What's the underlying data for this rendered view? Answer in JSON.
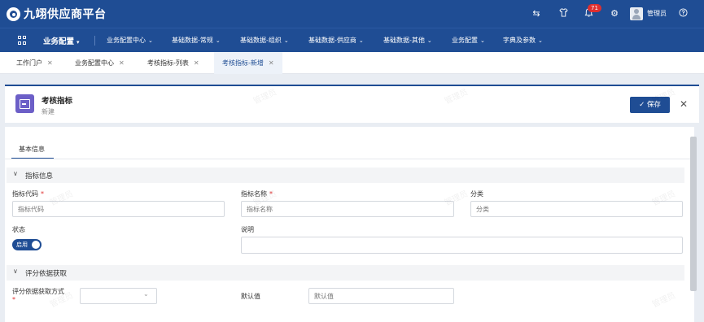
{
  "app": {
    "title": "九翊供应商平台",
    "user": "管理员",
    "notification_count": "71"
  },
  "topbar_icons": [
    "switch-icon",
    "shirt-icon",
    "bell-icon",
    "gear-icon",
    "help-icon"
  ],
  "nav": {
    "current": "业务配置",
    "items": [
      "业务配置中心",
      "基础数据-常规",
      "基础数据-组织",
      "基础数据-供应商",
      "基础数据-其他",
      "业务配置",
      "字典及参数"
    ]
  },
  "tabs": [
    {
      "label": "工作门户"
    },
    {
      "label": "业务配置中心"
    },
    {
      "label": "考核指标-列表"
    },
    {
      "label": "考核指标-新增"
    }
  ],
  "header": {
    "title": "考核指标",
    "subtitle": "新建",
    "save_label": "保存"
  },
  "sub_tab": "基本信息",
  "sections": {
    "basic": "指标信息",
    "scoring": "评分依据获取"
  },
  "fields": {
    "code": {
      "label": "指标代码",
      "placeholder": "指标代码"
    },
    "name": {
      "label": "指标名称",
      "placeholder": "指标名称"
    },
    "category": {
      "label": "分类",
      "placeholder": "分类"
    },
    "status": {
      "label": "状态",
      "value": "启用"
    },
    "description": {
      "label": "说明"
    },
    "scoring_method": {
      "label": "评分依据获取方式"
    },
    "default_value": {
      "label": "默认值",
      "placeholder": "默认值"
    }
  },
  "watermark": "管理员",
  "colors": {
    "primary": "#1f4d94",
    "accent_icon": "#6c5fc7",
    "required": "#e02f2f",
    "badge": "#e02f2f"
  }
}
